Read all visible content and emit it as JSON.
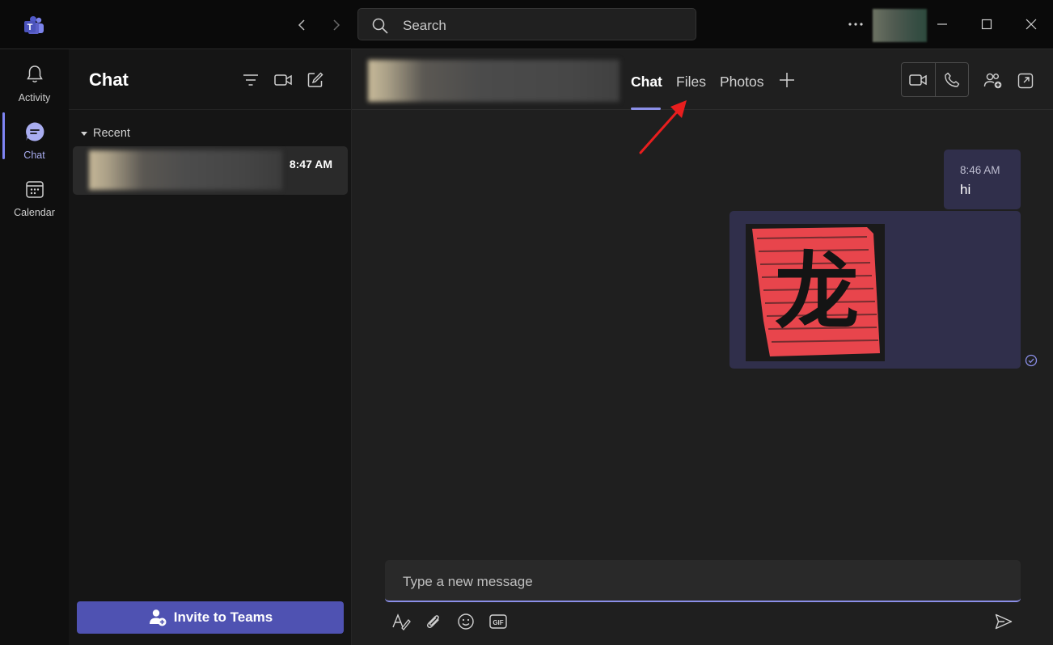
{
  "titlebar": {
    "search_placeholder": "Search",
    "icons": [
      "teams-logo-icon",
      "back-arrow-icon",
      "forward-arrow-icon",
      "search-icon",
      "more-options-icon",
      "minimize-icon",
      "maximize-icon",
      "close-icon"
    ]
  },
  "rail": {
    "items": [
      {
        "label": "Activity",
        "icon": "bell-icon"
      },
      {
        "label": "Chat",
        "icon": "chat-icon"
      },
      {
        "label": "Calendar",
        "icon": "calendar-icon"
      }
    ]
  },
  "chatlist": {
    "title": "Chat",
    "section": "Recent",
    "items": [
      {
        "time": "8:47 AM"
      }
    ],
    "invite_label": "Invite to Teams"
  },
  "header": {
    "tabs": [
      {
        "label": "Chat"
      },
      {
        "label": "Files"
      },
      {
        "label": "Photos"
      }
    ]
  },
  "messages": [
    {
      "time": "8:46 AM",
      "text": "hi"
    }
  ],
  "image_message": {
    "glyph": "龙"
  },
  "compose": {
    "placeholder": "Type a new message"
  },
  "colors": {
    "accent": "#7f85f5",
    "bubble": "#302f4b",
    "invite_button": "#4f52b2",
    "annotation_arrow": "#e81e1e",
    "stamp_red": "#e8454c"
  }
}
